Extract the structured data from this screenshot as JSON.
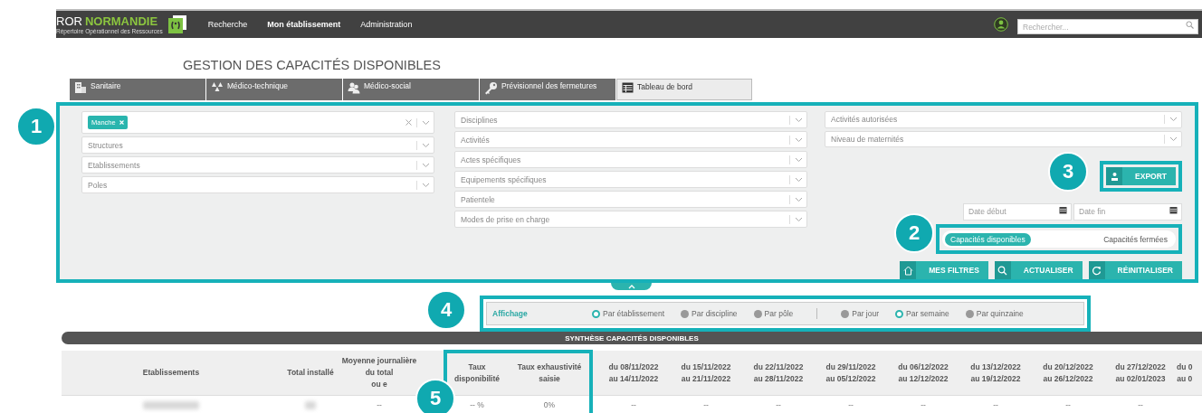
{
  "header": {
    "logo_ror": "ROR",
    "logo_region": "NORMANDIE",
    "logo_subtitle": "Répertoire Opérationnel des Ressources",
    "nav": [
      {
        "label": "Recherche",
        "selected": false
      },
      {
        "label": "Mon établissement",
        "selected": true
      },
      {
        "label": "Administration",
        "selected": false
      }
    ],
    "search": {
      "placeholder": "Rechercher..."
    }
  },
  "page_title": "GESTION DES CAPACITÉS DISPONIBLES",
  "tabs": [
    {
      "label": "Sanitaire",
      "selected": false
    },
    {
      "label": "Médico-technique",
      "selected": false
    },
    {
      "label": "Médico-social",
      "selected": false
    },
    {
      "label": "Prévisionnel des fermetures",
      "selected": false
    },
    {
      "label": "Tableau de bord",
      "selected": true
    }
  ],
  "filters": {
    "callout": "1",
    "columns": [
      [
        {
          "chips": [
            "Manche"
          ]
        },
        {
          "placeholder": "Structures"
        },
        {
          "placeholder": "Etablissements"
        },
        {
          "placeholder": "Poles"
        }
      ],
      [
        {
          "placeholder": "Disciplines"
        },
        {
          "placeholder": "Activités"
        },
        {
          "placeholder": "Actes spécifiques"
        },
        {
          "placeholder": "Equipements spécifiques"
        },
        {
          "placeholder": "Patientele"
        },
        {
          "placeholder": "Modes de prise en charge"
        }
      ],
      [
        {
          "placeholder": "Activités autorisées"
        },
        {
          "placeholder": "Niveau de maternités"
        }
      ]
    ],
    "export": {
      "callout": "3",
      "label": "EXPORT"
    },
    "dates": [
      {
        "placeholder": "Date début"
      },
      {
        "placeholder": "Date fin"
      }
    ],
    "mode": {
      "callout": "2",
      "options": [
        {
          "label": "Capacités disponibles",
          "selected": true
        },
        {
          "label": "Capacités fermées",
          "selected": false
        }
      ]
    },
    "actions": [
      "MES FILTRES",
      "ACTUALISER",
      "RÉINITIALISER"
    ]
  },
  "display": {
    "callout": "4",
    "label": "Affichage",
    "groups": [
      [
        {
          "label": "Par établissement",
          "selected": true
        },
        {
          "label": "Par discipline",
          "selected": false
        },
        {
          "label": "Par pôle",
          "selected": false
        }
      ],
      [
        {
          "label": "Par jour",
          "selected": false
        },
        {
          "label": "Par semaine",
          "selected": true
        },
        {
          "label": "Par quinzaine",
          "selected": false
        }
      ]
    ]
  },
  "section_title": "SYNTHÈSE CAPACITÉS DISPONIBLES",
  "table": {
    "callout": "5",
    "columns": [
      "Etablissements",
      "Total installé",
      "Moyenne journalière\ndu total\nou e",
      "Taux\ndisponibilité",
      "Taux exhaustivité\nsaisie",
      "du 08/11/2022\nau 14/11/2022",
      "du 15/11/2022\nau 21/11/2022",
      "du 22/11/2022\nau 28/11/2022",
      "du 29/11/2022\nau 05/12/2022",
      "du 06/12/2022\nau 12/12/2022",
      "du 13/12/2022\nau 19/12/2022",
      "du 20/12/2022\nau 26/12/2022",
      "du 27/12/2022\nau 02/01/2023",
      "du 0\nau 0"
    ],
    "rows": [
      {
        "cells": [
          {
            "kind": "redacted"
          },
          {
            "kind": "redacted"
          },
          {
            "kind": "text",
            "text": "--"
          },
          {
            "kind": "text",
            "text": "-- %"
          },
          {
            "kind": "text",
            "text": "0%"
          },
          {
            "kind": "text",
            "text": "--"
          },
          {
            "kind": "text",
            "text": "--"
          },
          {
            "kind": "text",
            "text": "--"
          },
          {
            "kind": "text",
            "text": "--"
          },
          {
            "kind": "text",
            "text": "--"
          },
          {
            "kind": "text",
            "text": "--"
          },
          {
            "kind": "text",
            "text": "--"
          },
          {
            "kind": "text",
            "text": "--"
          }
        ]
      }
    ]
  }
}
